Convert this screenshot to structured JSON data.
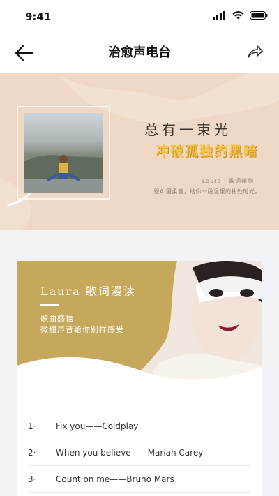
{
  "status": {
    "time": "9:41"
  },
  "nav": {
    "title": "治愈声电台",
    "back_icon": "arrow-left-icon",
    "share_icon": "share-icon"
  },
  "banner": {
    "headline1": "总有一束光",
    "headline2": "冲破孤独的黑暗",
    "meta": "Laura · 歌词读物",
    "subtitle": "很A 蛋柔音，给你一段温暖的独处时光。"
  },
  "card": {
    "title": "Laura  歌词漫读",
    "desc_line1": "歌曲感悟",
    "desc_line2": "微甜声音给你别样感受",
    "accent_color": "#c6a85c"
  },
  "playlist": [
    {
      "num": "1·",
      "name": "Fix you——Coldplay"
    },
    {
      "num": "2·",
      "name": "When you believe——Mariah Carey"
    },
    {
      "num": "3·",
      "name": "Count on me——Bruno Mars"
    }
  ]
}
